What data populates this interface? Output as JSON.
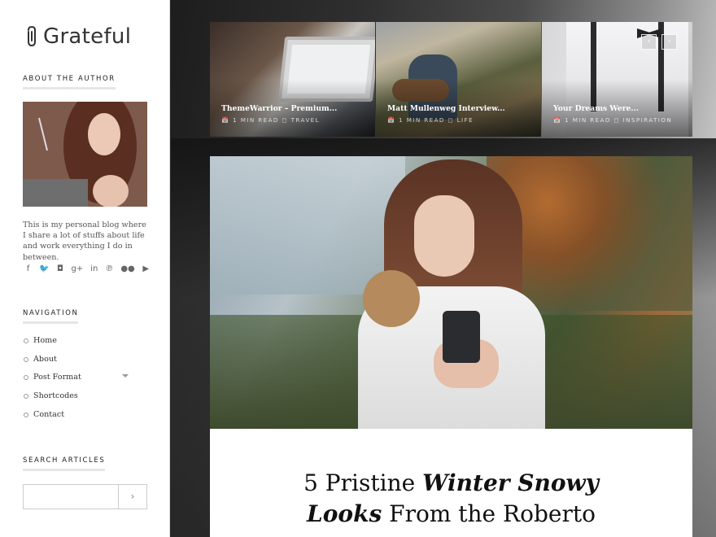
{
  "site": {
    "title": "Grateful"
  },
  "about": {
    "heading": "About the Author",
    "bio": "This is my personal blog where I share a lot of stuffs about life and work everything I do in between."
  },
  "social": [
    {
      "name": "facebook-icon",
      "glyph": "f"
    },
    {
      "name": "twitter-icon",
      "glyph": "🐦"
    },
    {
      "name": "instagram-icon",
      "glyph": "◘"
    },
    {
      "name": "google-plus-icon",
      "glyph": "g+"
    },
    {
      "name": "linkedin-icon",
      "glyph": "in"
    },
    {
      "name": "pinterest-icon",
      "glyph": "℗"
    },
    {
      "name": "flickr-icon",
      "glyph": "●●"
    },
    {
      "name": "youtube-icon",
      "glyph": "▶"
    }
  ],
  "navigation": {
    "heading": "Navigation",
    "items": [
      "Home",
      "About",
      "Post Format",
      "Shortcodes",
      "Contact"
    ]
  },
  "search": {
    "heading": "Search Articles",
    "placeholder": "",
    "button_glyph": "›"
  },
  "slider": {
    "prev_glyph": "‹",
    "next_glyph": "›",
    "slides": [
      {
        "title": "ThemeWarrior – Premium...",
        "meta": "📅 1 MIN READ  ◻ TRAVEL"
      },
      {
        "title": "Matt Mullenweg Interview...",
        "meta": "📅 1 MIN READ  ◻ LIFE"
      },
      {
        "title": "Your Dreams Were...",
        "meta": "📅 1 MIN READ  ◻ INSPIRATION"
      }
    ]
  },
  "featured": {
    "title_line1_plain": "5 Pristine ",
    "title_line1_em": "Winter Snowy",
    "title_line2_em": "Looks",
    "title_line2_plain": " From the Roberto"
  }
}
